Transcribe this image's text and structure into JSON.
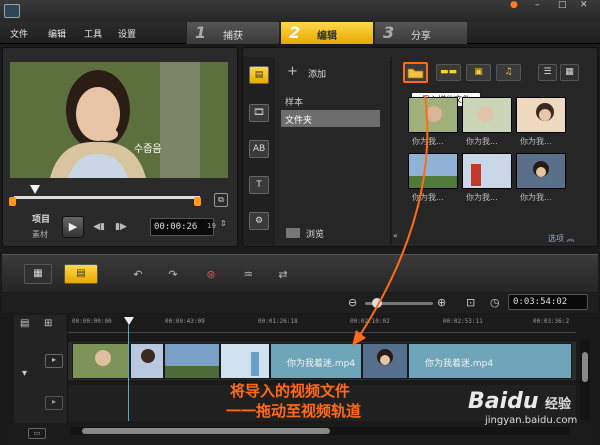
{
  "menu": [
    "文件",
    "编辑",
    "工具",
    "设置"
  ],
  "steps": [
    {
      "num": "1",
      "label": "捕获"
    },
    {
      "num": "2",
      "label": "编辑"
    },
    {
      "num": "3",
      "label": "分享"
    }
  ],
  "window_controls": [
    "●",
    "–",
    "□",
    "✕"
  ],
  "preview": {
    "overlay_text": "수줍음",
    "project_label": "项目",
    "clip_label": "素材",
    "timecode": "00:00:26",
    "timecode_frame": "19",
    "play_glyph": "▶",
    "prev_glyph": "◀▮",
    "next_glyph": "▮▶",
    "crop_glyph": "⧉",
    "fs_glyph": "⇕"
  },
  "library": {
    "add_label": "添加",
    "add_glyph": "+",
    "categories": [
      "样本",
      "文件夹"
    ],
    "browse_label": "浏览",
    "collapse_glyph": "«",
    "tooltip": "导入媒体文件",
    "options_label": "选项 ︽",
    "left_icons": [
      "▤",
      "🎞",
      "AB",
      "T",
      "⚙"
    ],
    "media_type_glyphs": [
      "▬▬",
      "▣",
      "♫"
    ],
    "view_glyphs": [
      "☰",
      "▦"
    ],
    "thumb_captions": [
      "你为我...",
      "你为我...",
      "你为我...",
      "你为我...",
      "你为我...",
      "你为我..."
    ]
  },
  "timeline": {
    "toolbar_glyphs": [
      "▦",
      "▤"
    ],
    "icons": [
      "↶",
      "↷",
      "⊛",
      "♒",
      "⇄"
    ],
    "zoom_out": "⊖",
    "zoom_in": "⊕",
    "fit_glyph": "⊡",
    "clock_glyph": "◷",
    "duration": "0:03:54:02",
    "ruler_labels": [
      "00:00:00:00",
      "00:00:43:09",
      "00:01:26:18",
      "00:02:10:02",
      "00:02:53:11",
      "00:03:36:2"
    ],
    "clip_names": [
      "你为我着迷.mp4",
      "你为我着迷.mp4"
    ],
    "left_glyphs": [
      "▤",
      "⊞",
      "▾",
      "▸"
    ],
    "bottom_glyph": "▭"
  },
  "caption": {
    "line1": "将导入的视频文件",
    "line2": "一一拖动至视频轨道"
  },
  "watermark": {
    "brand": "Baidu",
    "suffix": "经验",
    "url": "jingyan.baidu.com"
  },
  "colors": {
    "accent_yellow": "#f0b800",
    "highlight_orange": "#ff6b1a",
    "bg": "#1a1a1a"
  }
}
